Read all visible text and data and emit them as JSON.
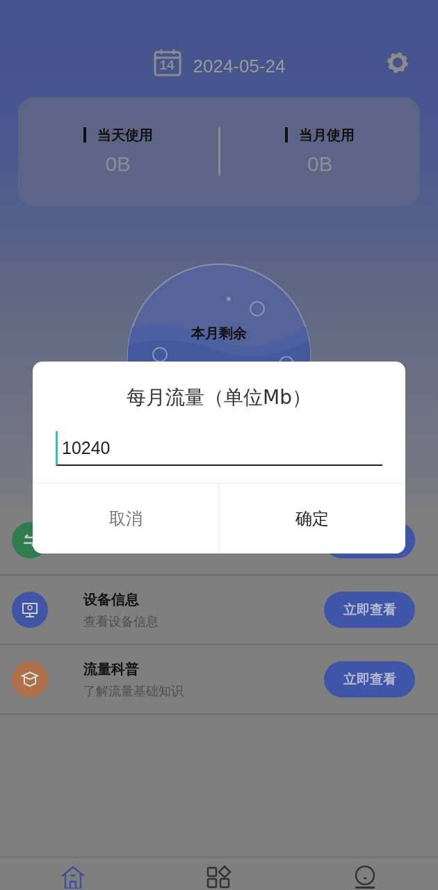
{
  "header": {
    "calendar_day": "14",
    "date": "2024-05-24"
  },
  "usage": [
    {
      "label": "当天使用",
      "value": "0B"
    },
    {
      "label": "当月使用",
      "value": "0B"
    }
  ],
  "ball": {
    "label": "本月剩余"
  },
  "tools": [
    {
      "kind": "convert",
      "color": "#2e7d4f"
    },
    {
      "kind": "device",
      "title": "设备信息",
      "subtitle": "查看设备信息",
      "button": "立即查看",
      "color": "#3e55a8"
    },
    {
      "kind": "learn",
      "title": "流量科普",
      "subtitle": "了解流量基础知识",
      "button": "立即查看",
      "color": "#b0704a"
    }
  ],
  "dialog": {
    "title": "每月流量（单位Mb）",
    "value": "10240",
    "buttons": [
      {
        "label": "取消",
        "kind": "cancel"
      },
      {
        "label": "确定",
        "kind": "confirm"
      }
    ]
  },
  "nav": [
    {
      "kind": "home",
      "selected": true
    },
    {
      "kind": "apps",
      "selected": false
    },
    {
      "kind": "profile",
      "selected": false
    }
  ]
}
